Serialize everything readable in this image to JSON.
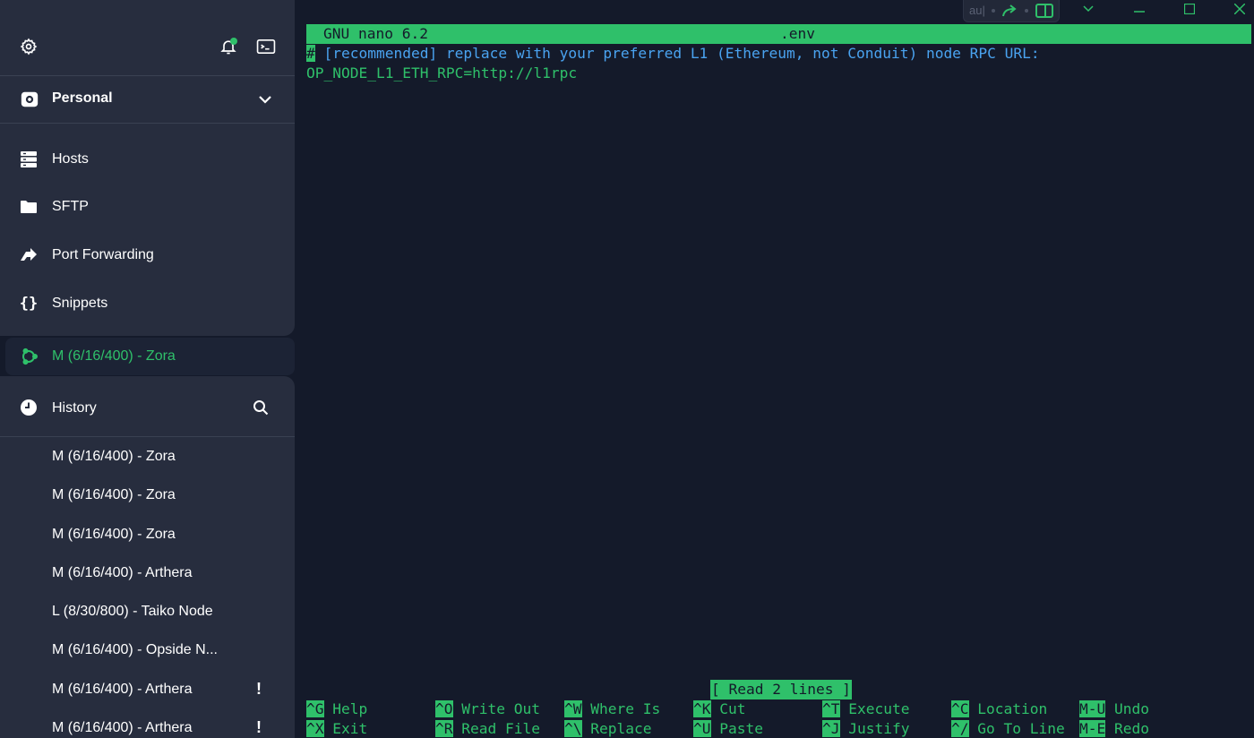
{
  "colors": {
    "accent": "#2fc06a",
    "terminal_bg": "#141a2a",
    "sidebar_card": "#272d3e",
    "comment": "#4aa3f0"
  },
  "sidebar": {
    "vault": {
      "label": "Personal"
    },
    "nav": [
      {
        "label": "Hosts",
        "icon": "hosts-icon"
      },
      {
        "label": "SFTP",
        "icon": "folder-icon"
      },
      {
        "label": "Port Forwarding",
        "icon": "port-forward-icon"
      },
      {
        "label": "Snippets",
        "icon": "braces-icon"
      }
    ],
    "active_session": {
      "label": "M (6/16/400) - Zora",
      "icon": "ubuntu-icon"
    },
    "history": {
      "label": "History",
      "items": [
        {
          "label": "M (6/16/400) - Zora",
          "warning": ""
        },
        {
          "label": "M (6/16/400) - Zora",
          "warning": ""
        },
        {
          "label": "M (6/16/400) - Zora",
          "warning": ""
        },
        {
          "label": "M (6/16/400) - Arthera",
          "warning": ""
        },
        {
          "label": "L (8/30/800) - Taiko Node",
          "warning": ""
        },
        {
          "label": "M (6/16/400) - Opside N...",
          "warning": ""
        },
        {
          "label": "M (6/16/400) - Arthera",
          "warning": "!"
        },
        {
          "label": "M (6/16/400) - Arthera",
          "warning": "!"
        }
      ]
    }
  },
  "toolbar": {
    "input_hint": "au|"
  },
  "terminal": {
    "header": {
      "app": "GNU nano 6.2",
      "filename": ".env"
    },
    "lines": {
      "cursor_char": "#",
      "comment_rest": " [recommended] replace with your preferred L1 (Ethereum, not Conduit) node RPC URL:",
      "line2": "OP_NODE_L1_ETH_RPC=http://l1rpc"
    },
    "status": "[ Read 2 lines ]",
    "shortcuts": [
      [
        {
          "key": "^G",
          "label": "Help"
        },
        {
          "key": "^O",
          "label": "Write Out"
        },
        {
          "key": "^W",
          "label": "Where Is"
        },
        {
          "key": "^K",
          "label": "Cut"
        },
        {
          "key": "^T",
          "label": "Execute"
        },
        {
          "key": "^C",
          "label": "Location"
        },
        {
          "key": "M-U",
          "label": "Undo"
        }
      ],
      [
        {
          "key": "^X",
          "label": "Exit"
        },
        {
          "key": "^R",
          "label": "Read File"
        },
        {
          "key": "^\\",
          "label": "Replace"
        },
        {
          "key": "^U",
          "label": "Paste"
        },
        {
          "key": "^J",
          "label": "Justify"
        },
        {
          "key": "^/",
          "label": "Go To Line"
        },
        {
          "key": "M-E",
          "label": "Redo"
        }
      ]
    ]
  }
}
